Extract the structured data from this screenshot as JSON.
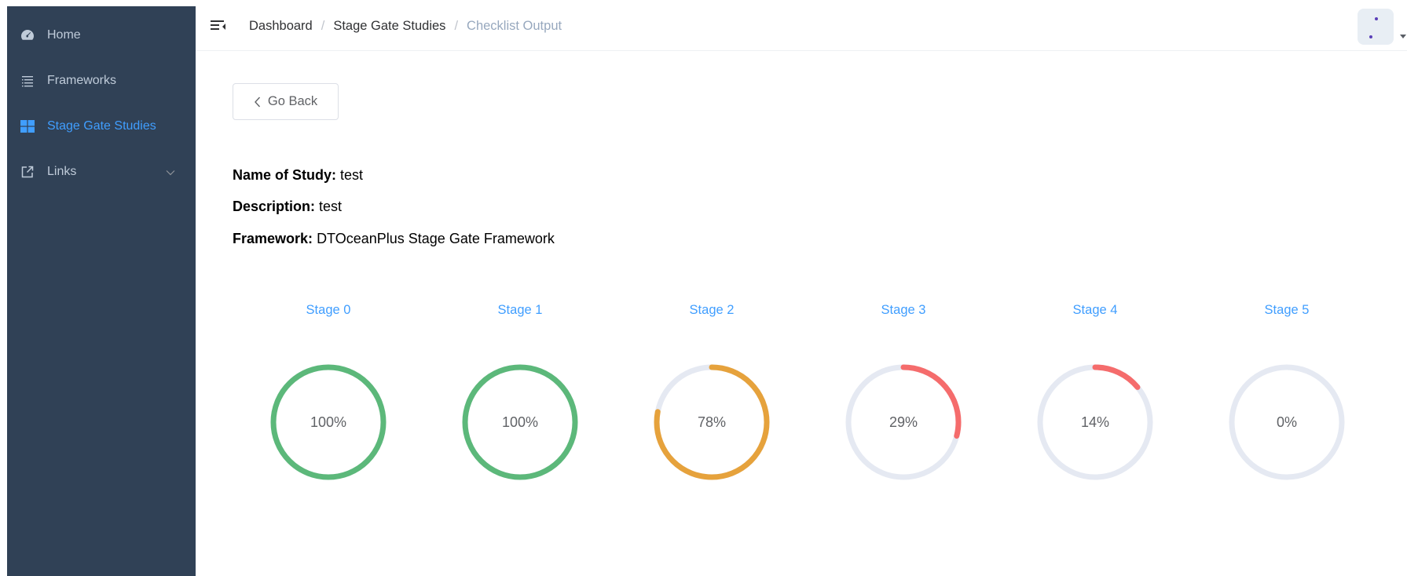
{
  "sidebar": {
    "items": [
      {
        "label": "Home",
        "icon": "dashboard-icon",
        "active": false
      },
      {
        "label": "Frameworks",
        "icon": "list-icon",
        "active": false
      },
      {
        "label": "Stage Gate Studies",
        "icon": "grid-icon",
        "active": true
      },
      {
        "label": "Links",
        "icon": "external-link-icon",
        "active": false
      }
    ]
  },
  "breadcrumb": [
    "Dashboard",
    "Stage Gate Studies",
    "Checklist Output"
  ],
  "go_back_label": "Go Back",
  "study": {
    "name_label": "Name of Study:",
    "name": "test",
    "description_label": "Description:",
    "description": "test",
    "framework_label": "Framework:",
    "framework": "DTOceanPlus Stage Gate Framework"
  },
  "stages": [
    {
      "label": "Stage 0",
      "percent": 100,
      "text": "100%"
    },
    {
      "label": "Stage 1",
      "percent": 100,
      "text": "100%"
    },
    {
      "label": "Stage 2",
      "percent": 78,
      "text": "78%"
    },
    {
      "label": "Stage 3",
      "percent": 29,
      "text": "29%"
    },
    {
      "label": "Stage 4",
      "percent": 14,
      "text": "14%"
    },
    {
      "label": "Stage 5",
      "percent": 0,
      "text": "0%"
    }
  ],
  "colors": {
    "sidebar_bg": "#304156",
    "accent": "#409eff",
    "success": "#5cb87a",
    "warning": "#e6a23c",
    "danger": "#f56c6c",
    "track": "#e5e9f2"
  }
}
